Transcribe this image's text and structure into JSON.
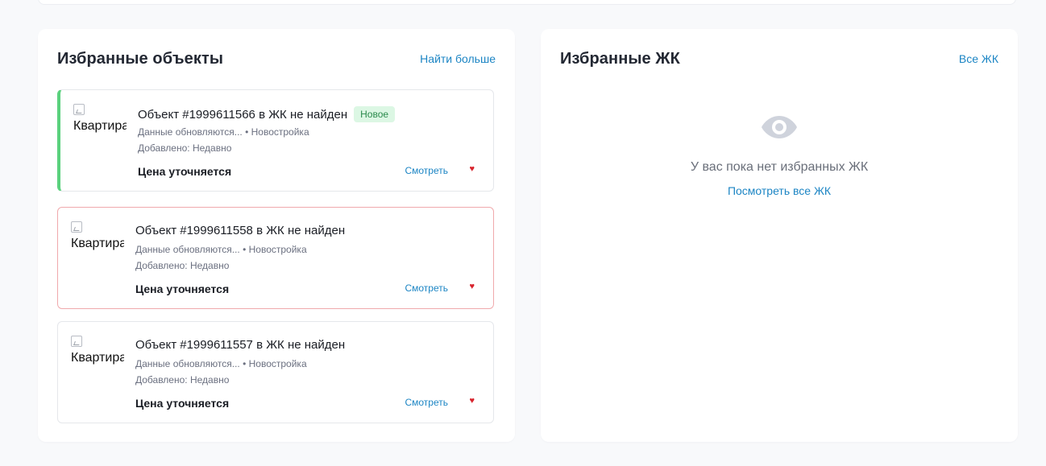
{
  "favorites_objects": {
    "title": "Избранные объекты",
    "find_more_label": "Найти больше",
    "cards": [
      {
        "title": "Объект #1999611566 в ЖК не найден",
        "badge": "Новое",
        "image_alt": "Квартира",
        "meta_status": "Данные обновляются...",
        "meta_type": "Новостройка",
        "added": "Добавлено: Недавно",
        "price": "Цена уточняется",
        "view_label": "Смотреть",
        "heart": "♥"
      },
      {
        "title": "Объект #1999611558 в ЖК не найден",
        "badge": "",
        "image_alt": "Квартира",
        "meta_status": "Данные обновляются...",
        "meta_type": "Новостройка",
        "added": "Добавлено: Недавно",
        "price": "Цена уточняется",
        "view_label": "Смотреть",
        "heart": "♥"
      },
      {
        "title": "Объект #1999611557 в ЖК не найден",
        "badge": "",
        "image_alt": "Квартира",
        "meta_status": "Данные обновляются...",
        "meta_type": "Новостройка",
        "added": "Добавлено: Недавно",
        "price": "Цена уточняется",
        "view_label": "Смотреть",
        "heart": "♥"
      }
    ]
  },
  "favorites_complexes": {
    "title": "Избранные ЖК",
    "all_label": "Все ЖК",
    "empty_icon": "eye-icon",
    "empty_text": "У вас пока нет избранных ЖК",
    "empty_link": "Посмотреть все ЖК"
  },
  "meta_separator": "•",
  "colors": {
    "accent_link": "#1c85c4",
    "new_border": "#5ad17d",
    "error_border": "#f0a9ac",
    "badge_bg": "#dcf7e4",
    "badge_text": "#2a8a4c",
    "heart": "#d8242d"
  }
}
